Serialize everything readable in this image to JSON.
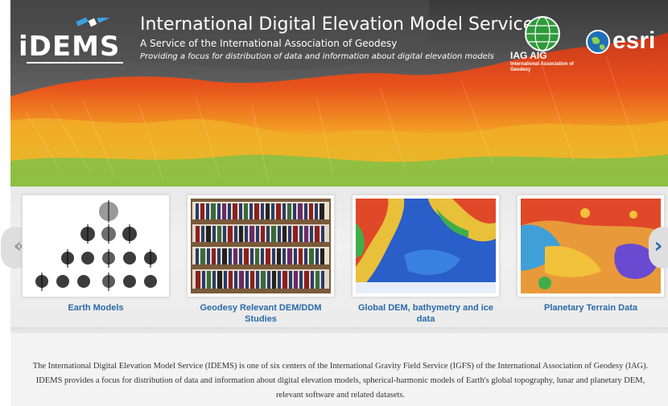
{
  "banner": {
    "logo_text": "iDEMS",
    "title": "International Digital Elevation Model Service",
    "subtitle": "A Service of the International Association of Geodesy",
    "tagline": "Providing a focus for distribution of data and information about digital elevation models",
    "iag_logo_text": "IAG AIG",
    "iag_logo_subtext": "International Association of Geodesy",
    "esri_logo_text": "esri"
  },
  "carousel": {
    "prev_label": "«",
    "next_label": "›",
    "items": [
      {
        "label": "Earth Models",
        "thumb_icon": "spherical-harmonics-icon"
      },
      {
        "label": "Geodesy Relevant DEM/DDM Studies",
        "thumb_icon": "bookshelf-icon"
      },
      {
        "label": "Global DEM, bathymetry and ice data",
        "thumb_icon": "world-dem-map-icon"
      },
      {
        "label": "Planetary Terrain Data",
        "thumb_icon": "planetary-terrain-map-icon"
      }
    ]
  },
  "description": {
    "text": "The International Digital Elevation Model Service (IDEMS) is one of six centers of the International Gravity Field Service (IGFS) of the International Association of Geodesy (IAG). IDEMS provides a focus for distribution of data and information about digital elevation models, spherical-harmonic models of Earth's global topography, lunar and planetary DEM, relevant software and related datasets."
  },
  "colors": {
    "link_blue": "#2a6aa8",
    "terrain_red": "#e0481a",
    "terrain_orange": "#f2a21e",
    "terrain_green": "#5fb04a",
    "logo_blue": "#1e6fb8"
  }
}
